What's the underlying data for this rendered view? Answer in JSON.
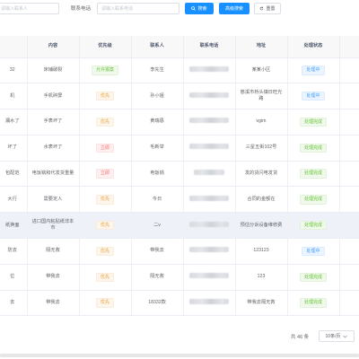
{
  "search": {
    "name_placeholder": "请输入联系人",
    "phone_label": "联系电话",
    "phone_placeholder": "请输入联系电话",
    "search_button": "搜索",
    "advanced_button": "高级搜索",
    "reset_button": "重置"
  },
  "table": {
    "columns": [
      "",
      "内容",
      "优先级",
      "联系人",
      "联系电话",
      "地址",
      "处理状态",
      ""
    ],
    "rows": [
      {
        "c0": "32",
        "content": "床铺破裂",
        "priority": "允许报案",
        "ptype": "success",
        "contact": "李先生",
        "address": "某某小区",
        "status": "处理中",
        "stype": "info"
      },
      {
        "c0": "机",
        "content": "手机碎屏",
        "priority": "优先",
        "ptype": "warning",
        "contact": "孙小姐",
        "address": "慈溪市桥头镇日旺光路",
        "status": "处理中",
        "stype": "info"
      },
      {
        "c0": "漏水了",
        "content": "手表坏了",
        "priority": "优先",
        "ptype": "warning",
        "contact": "黄瑞恩",
        "address": "vgim",
        "status": "处理完成",
        "stype": "done"
      },
      {
        "c0": "坏了",
        "content": "水表坏了",
        "priority": "立即",
        "ptype": "danger",
        "contact": "毛新举",
        "address": "三星五街102号",
        "status": "处理完成",
        "stype": "done"
      },
      {
        "c0": "包配范",
        "content": "电饭锅和代发货重量",
        "priority": "立即",
        "ptype": "danger",
        "contact": "电饭锅",
        "address": "发的货闪电发货",
        "status": "处理完成",
        "stype": "done"
      },
      {
        "c0": "大行",
        "content": "需要定人",
        "priority": "优先",
        "ptype": "warning",
        "contact": "今日",
        "address": "合同的金额在",
        "status": "处理完成",
        "stype": "done"
      },
      {
        "c0": "纸换面",
        "content": "进口国内粘贴纸非本市",
        "priority": "优先",
        "ptype": "warning",
        "contact": "二v",
        "address": "预估分诉设备维修费",
        "status": "处理完成",
        "stype": "done"
      },
      {
        "c0": "防去",
        "content": "隔无救",
        "priority": "优先",
        "ptype": "warning",
        "contact": "带我去",
        "address": "123123",
        "status": "处理中",
        "stype": "info"
      },
      {
        "c0": "位",
        "content": "带我去",
        "priority": "优先",
        "ptype": "warning",
        "contact": "隔无救",
        "address": "123",
        "status": "处理完成",
        "stype": "done"
      },
      {
        "c0": "去",
        "content": "带我去",
        "priority": "优先",
        "ptype": "warning",
        "contact": "18332款",
        "address": "带我去隔无救",
        "status": "处理完成",
        "stype": "done"
      }
    ]
  },
  "pagination": {
    "total": "共 46 条",
    "page_size": "10条/页"
  }
}
